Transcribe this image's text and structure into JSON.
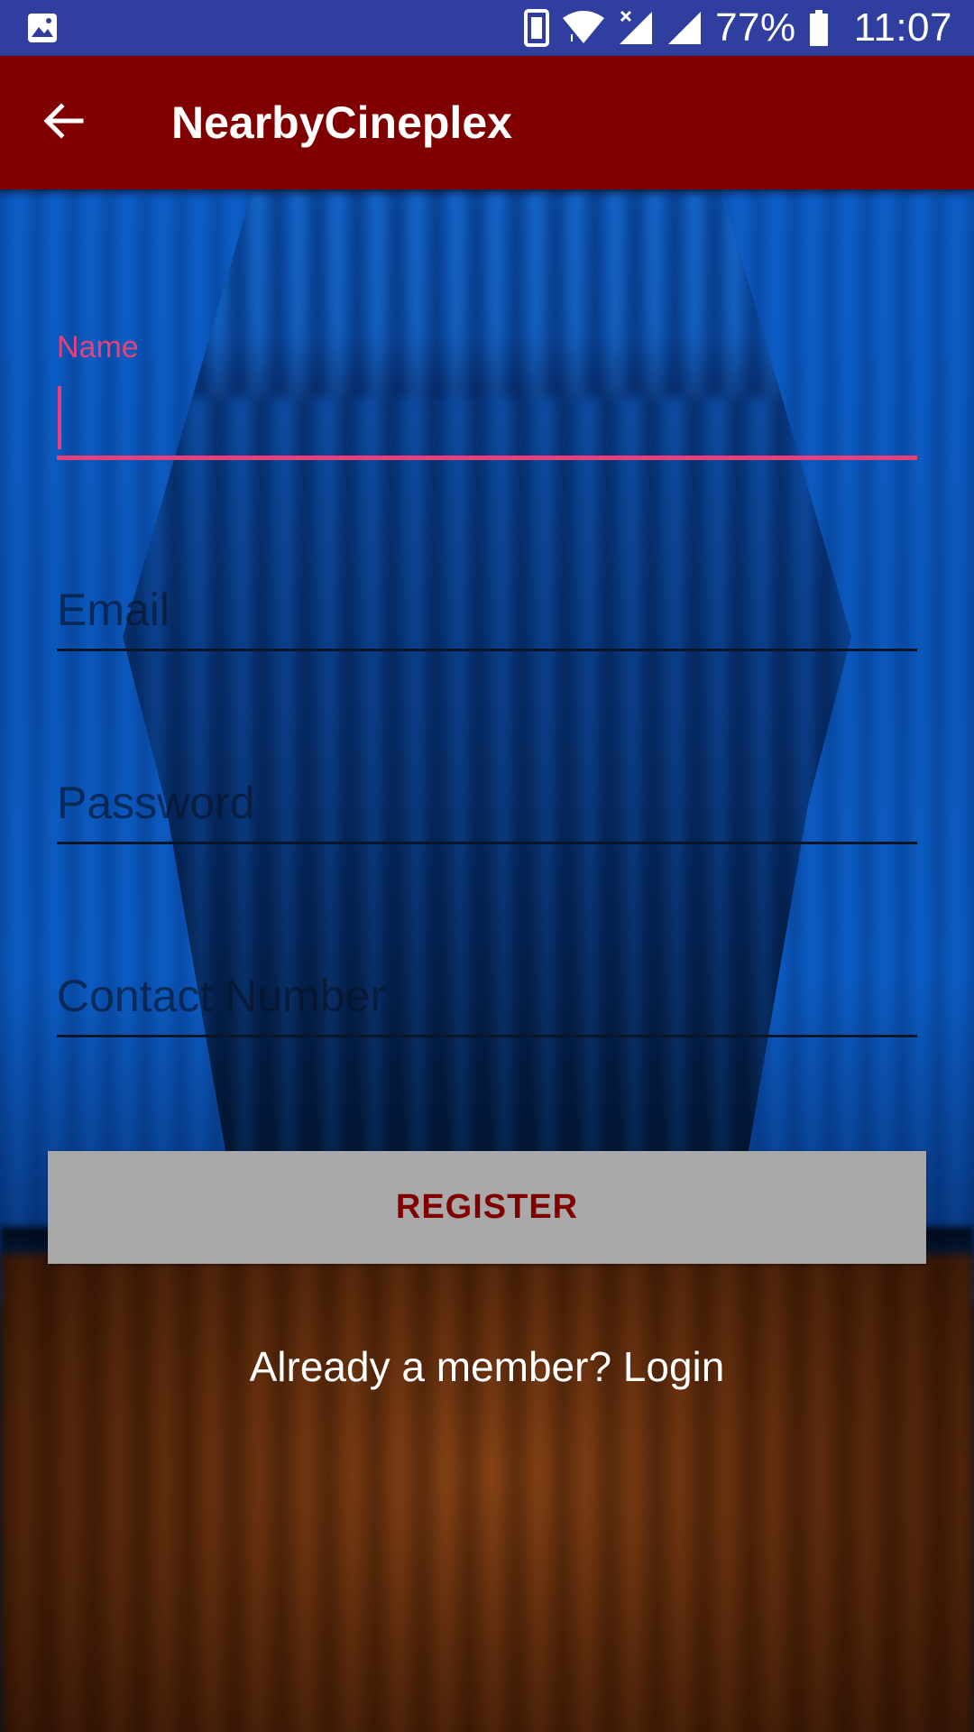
{
  "status_bar": {
    "battery_percent": "77%",
    "time": "11:07",
    "icons": [
      "image-notification-icon",
      "phone-vibrate-icon",
      "wifi-icon",
      "signal-no-data-icon",
      "signal-icon",
      "battery-icon"
    ]
  },
  "app_bar": {
    "title": "NearbyCineplex",
    "back_icon": "arrow-back-icon"
  },
  "form": {
    "name": {
      "label": "Name",
      "value": ""
    },
    "email": {
      "placeholder": "Email",
      "value": ""
    },
    "password": {
      "placeholder": "Password",
      "value": ""
    },
    "contact": {
      "placeholder": "Contact Number",
      "value": ""
    },
    "register_label": "REGISTER",
    "login_link": "Already a member? Login"
  },
  "colors": {
    "status_bar": "#303f9f",
    "app_bar": "#800000",
    "accent": "#e9407a",
    "button_bg": "#a9a9a9",
    "button_text": "#800000"
  }
}
